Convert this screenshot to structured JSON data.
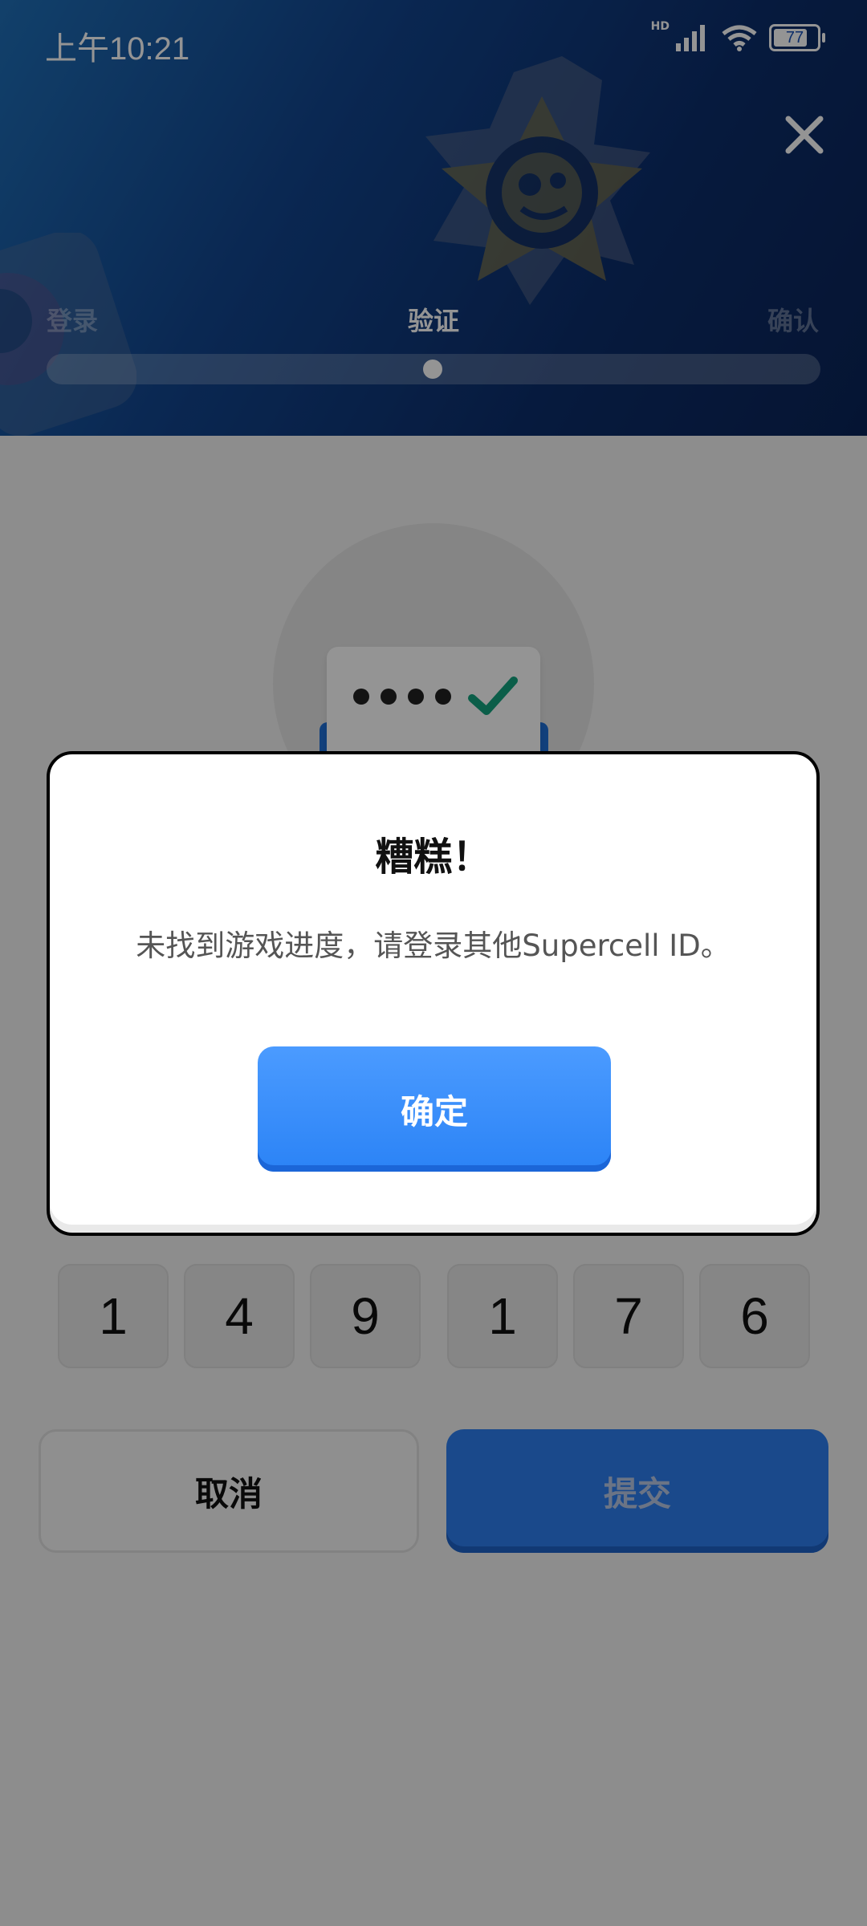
{
  "status_bar": {
    "time": "上午10:21",
    "network_label": "HD",
    "battery_level": "77"
  },
  "header": {
    "steps": [
      {
        "label": "登录"
      },
      {
        "label": "验证"
      },
      {
        "label": "确认"
      }
    ],
    "current_step": 2,
    "accent_color": "#12458e"
  },
  "code": {
    "digits": [
      "1",
      "4",
      "9",
      "1",
      "7",
      "6"
    ]
  },
  "actions": {
    "cancel_label": "取消",
    "submit_label": "提交",
    "submit_color": "#2d7ef0"
  },
  "dialog": {
    "title": "糟糕！",
    "message": "未找到游戏进度，请登录其他Supercell ID。",
    "ok_label": "确定",
    "ok_color": "#2b83f6"
  }
}
